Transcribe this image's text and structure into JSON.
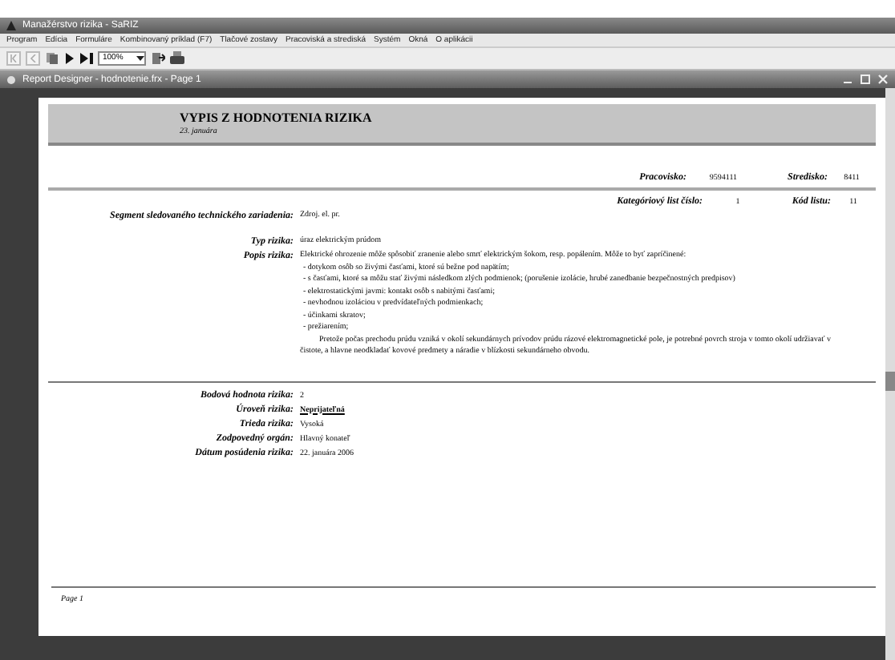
{
  "app_window": {
    "title": "Manažérstvo rizika - SaRIZ"
  },
  "menu": [
    "Program",
    "Edícia",
    "Formuláre",
    "Kombinovaný príklad (F7)",
    "Tlačové zostavy",
    "Pracoviská a strediská",
    "Systém",
    "Okná",
    "O aplikácii"
  ],
  "toolbar": {
    "zoom": "100%"
  },
  "report_window": {
    "title": "Report Designer - hodnotenie.frx - Page 1"
  },
  "report": {
    "title": "VYPIS Z HODNOTENIA RIZIKA",
    "date": "23. januára",
    "header_fields": [
      {
        "label": "Pracovisko:",
        "value": "9594111"
      },
      {
        "label": "Stredisko:",
        "value": "8411"
      }
    ],
    "sheet_fields": [
      {
        "label": "Kategóriový list číslo:",
        "value": "1"
      },
      {
        "label": "Kód listu:",
        "value": "11"
      }
    ],
    "segment": {
      "label": "Segment sledovaného technického zariadenia:",
      "value": "Zdroj. el. pr."
    },
    "risk_type": {
      "label": "Typ rizika:",
      "value": "úraz elektrickým prúdom"
    },
    "description": {
      "label": "Popis rizika:",
      "lines": [
        "Elektrické ohrozenie môže spôsobiť zranenie alebo smrť elektrickým šokom, resp. popálením. Môže to byť zapríčinené:",
        "- dotykom osôb so živými časťami, ktoré sú bežne pod napätím;",
        "- s časťami, ktoré sa môžu stať živými následkom zlých podmienok; (porušenie izolácie, hrubé zanedbanie bezpečnostných predpisov)",
        "- elektrostatickými javmi: kontakt osôb s nabitými časťami;",
        "- nevhodnou izoláciou v predvídateľných podmienkach;",
        "- účinkami skratov;",
        "- prežiarením;"
      ],
      "paragraph": "Pretože počas prechodu prúdu vzniká v okolí sekundárnych prívodov prúdu rázové elektromagnetické pole, je potrebné povrch stroja v tomto okolí udržiavať v čistote, a hlavne neodkladať kovové predmety a náradie v blízkosti sekundárneho obvodu."
    },
    "assessment": [
      {
        "label": "Bodová hodnota rizika:",
        "value": "2",
        "emphasized": false
      },
      {
        "label": "Úroveň rizika:",
        "value": "Neprijateľná",
        "emphasized": true
      },
      {
        "label": "Trieda rizika:",
        "value": "Vysoká",
        "emphasized": false
      },
      {
        "label": "Zodpovedný orgán:",
        "value": "Hlavný konateľ",
        "emphasized": false
      },
      {
        "label": "Dátum posúdenia rizika:",
        "value": "22. januára 2006",
        "emphasized": false
      }
    ],
    "footer": "Page 1"
  }
}
